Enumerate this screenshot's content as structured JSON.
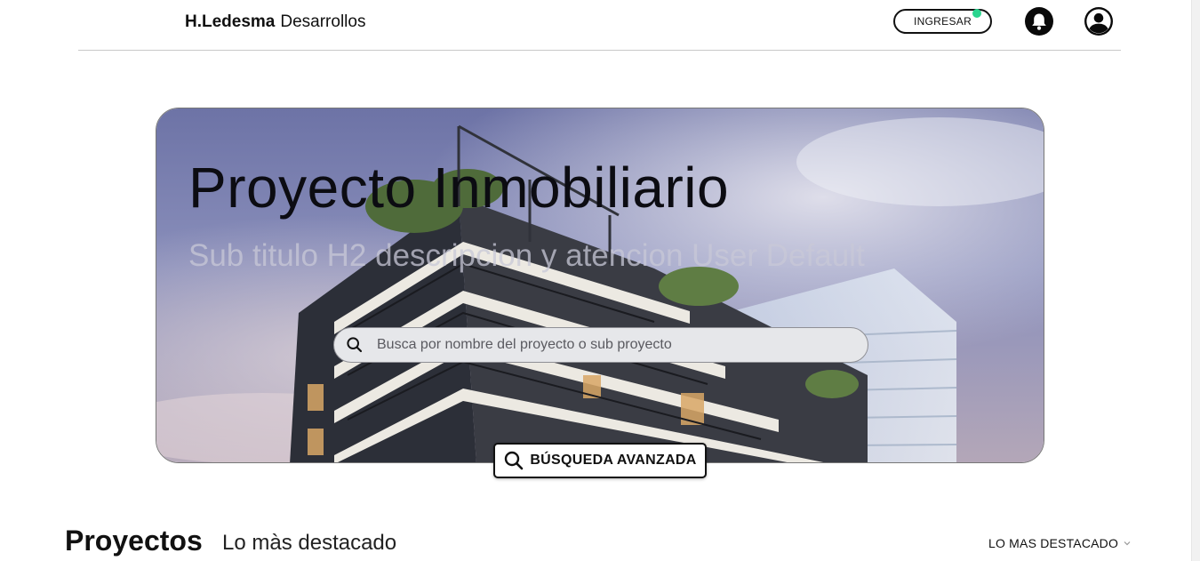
{
  "header": {
    "brand_strong": "H.Ledesma",
    "brand_light": "Desarrollos",
    "login_label": "INGRESAR",
    "notification_icon": "bell-icon",
    "user_icon": "user-avatar-icon",
    "notification_dot_color": "#2bd58f"
  },
  "hero": {
    "title": "Proyecto Inmobiliario",
    "subtitle": "Sub titulo H2 descripcion y atencion User Default",
    "search_placeholder": "Busca por nombre del proyecto o sub proyecto",
    "search_icon": "search-icon",
    "advanced_search_label": "BÚSQUEDA AVANZADA"
  },
  "section": {
    "title": "Proyectos",
    "subtitle": "Lo màs destacado",
    "sort_label": "LO MAS DESTACADO",
    "sort_icon": "chevron-down-icon"
  }
}
